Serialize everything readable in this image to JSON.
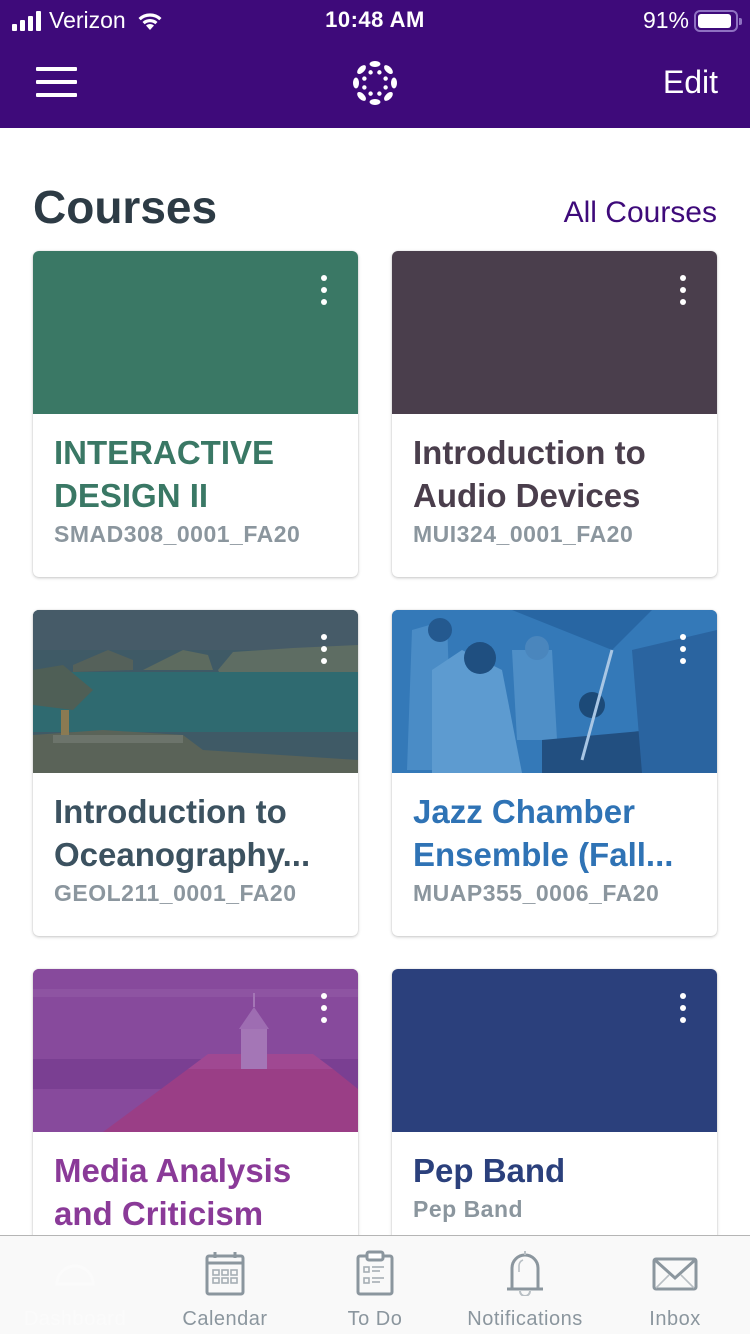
{
  "status_bar": {
    "carrier": "Verizon",
    "time": "10:48 AM",
    "battery_percent_label": "91%",
    "battery_level": 0.91
  },
  "nav": {
    "menu_icon": "hamburger-icon",
    "logo_icon": "canvas-logo-icon",
    "edit_label": "Edit"
  },
  "colors": {
    "brand": "#3e0a7a",
    "heading": "#2d3b45",
    "muted": "#8b969e"
  },
  "courses": {
    "heading": "Courses",
    "all_courses_label": "All Courses",
    "items": [
      {
        "title": "INTERACTIVE DESIGN II",
        "code": "SMAD308_0001_FA20",
        "color": "#3a7865",
        "image": "none"
      },
      {
        "title": "Introduction to Audio Devices",
        "code": "MUI324_0001_FA20",
        "color": "#4a3e4c",
        "image": "none"
      },
      {
        "title": "Introduction to Oceanography...",
        "code": "GEOL211_0001_FA20",
        "color": "#3c5260",
        "image": "coastal-bay-photo"
      },
      {
        "title": "Jazz Chamber Ensemble (Fall...",
        "code": "MUAP355_0006_FA20",
        "color": "#2f73b5",
        "image": "jazz-musicians-photo"
      },
      {
        "title": "Media Analysis and Criticism",
        "code": "",
        "color": "#8a3a98",
        "image": "building-cupola-photo"
      },
      {
        "title": "Pep Band",
        "code": "Pep Band",
        "color": "#2b407c",
        "image": "none"
      }
    ]
  },
  "tabbar": {
    "tabs": [
      {
        "label": "Dashboard",
        "icon": "dashboard-icon",
        "selected": true
      },
      {
        "label": "Calendar",
        "icon": "calendar-icon",
        "selected": false
      },
      {
        "label": "To Do",
        "icon": "clipboard-icon",
        "selected": false
      },
      {
        "label": "Notifications",
        "icon": "bell-icon",
        "selected": false
      },
      {
        "label": "Inbox",
        "icon": "envelope-icon",
        "selected": false
      }
    ]
  }
}
